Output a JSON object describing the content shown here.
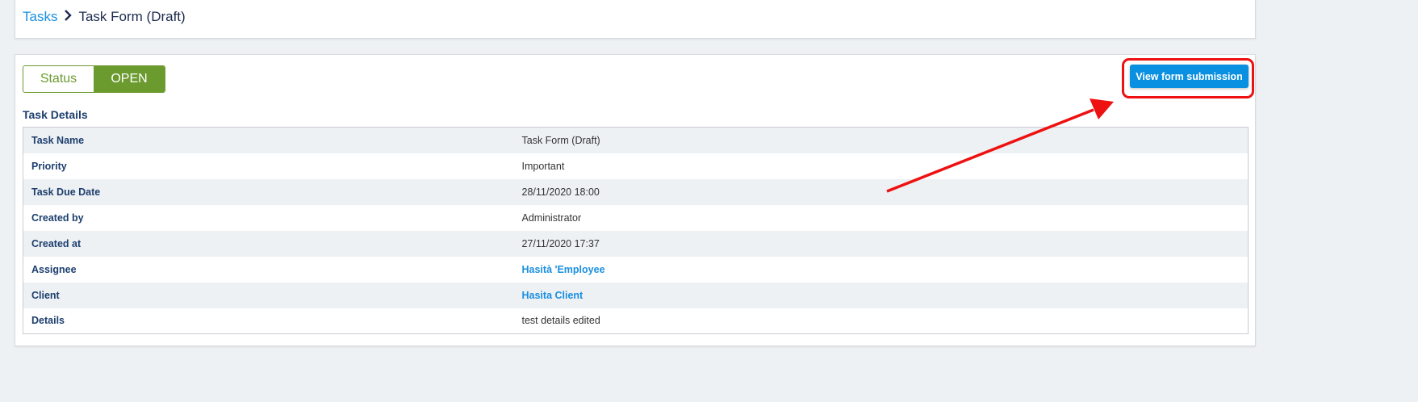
{
  "breadcrumb": {
    "root": "Tasks",
    "current": "Task Form (Draft)"
  },
  "status": {
    "label": "Status",
    "value": "OPEN"
  },
  "actions": {
    "view_submission": "View form submission"
  },
  "section_title": "Task Details",
  "details": [
    {
      "label": "Task Name",
      "value": "Task Form (Draft)",
      "link": false
    },
    {
      "label": "Priority",
      "value": "Important",
      "link": false
    },
    {
      "label": "Task Due Date",
      "value": "28/11/2020 18:00",
      "link": false
    },
    {
      "label": "Created by",
      "value": "Administrator",
      "link": false
    },
    {
      "label": "Created at",
      "value": "27/11/2020 17:37",
      "link": false
    },
    {
      "label": "Assignee",
      "value": "Hasità 'Employee",
      "link": true
    },
    {
      "label": "Client",
      "value": "Hasita Client",
      "link": true
    },
    {
      "label": "Details",
      "value": "test details edited",
      "link": false
    }
  ],
  "colors": {
    "accent": "#0a90e0",
    "status": "#6b9a2f",
    "annotation": "#ee1111"
  }
}
